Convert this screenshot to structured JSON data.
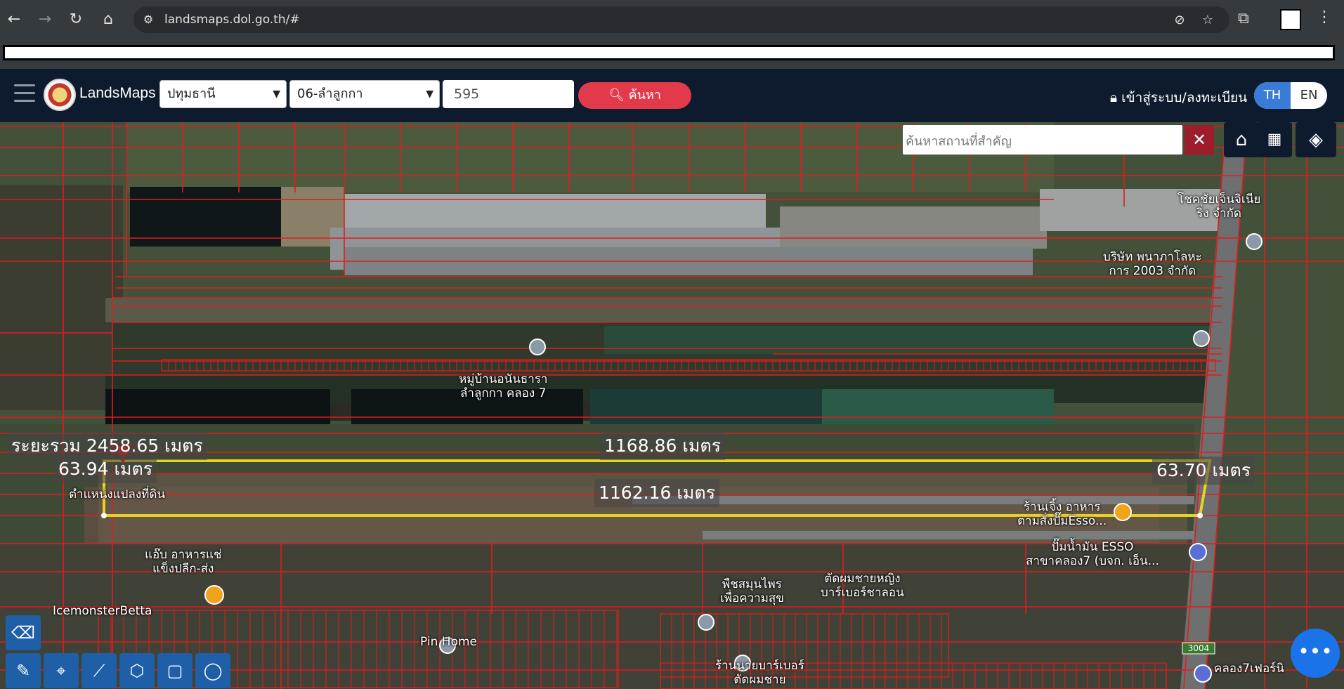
{
  "browser": {
    "url": "landsmaps.dol.go.th/#"
  },
  "header": {
    "brand": "LandsMaps",
    "province": "ปทุมธานี",
    "district": "06-ลำลูกกา",
    "parcel_value": "595",
    "search_label": "ค้นหา",
    "login_label": "เข้าสู่ระบบ/ลงทะเบียน",
    "lang_th": "TH",
    "lang_en": "EN"
  },
  "map": {
    "place_search_placeholder": "ค้นหาสถานที่สำคัญ",
    "measurements": {
      "total": "ระยะรวม 2458.65 เมตร",
      "top": "1168.86 เมตร",
      "bottom": "1162.16 เมตร",
      "left": "63.94 เมตร",
      "right": "63.70 เมตร"
    },
    "pois": {
      "chokchai_1": "โชคชัยเจ็นจิเนีย",
      "chokchai_2": "ริ่ง จำกัด",
      "company_1": "บริษัท พนาภาโลหะ",
      "company_2": "การ 2003 จำกัด",
      "village_1": "หมู่บ้านอนันธารา",
      "village_2": "ลำลูกกา คลอง 7",
      "parcel_location": "ตำแหน่งแปลงที่ดิน",
      "restaurant_1": "ร้านเจิ้ง อาหาร",
      "restaurant_2": "ตามสั่งปั๊มEsso...",
      "esso_1": "ปั๊มน้ำมัน ESSO",
      "esso_2": "สาขาคลอง7 (บจก. เอ็น...",
      "frozen_1": "แอ๊บ อาหารแช่",
      "frozen_2": "แข็งปลีก-ส่ง",
      "icemonster": "IcemonsterBetta",
      "herb_1": "พืชสมุนไพร",
      "herb_2": "เพื่อความสุข",
      "barber_1": "ตัดผมชายหญิง",
      "barber_2": "บาร์เบอร์ชาลอน",
      "pinhome": "Pin Home",
      "barber2_1": "ร้านนายบาร์เบอร์",
      "barber2_2": "ตัดผมชาย",
      "klong7": "คลอง7เฟอร์นิ",
      "road_sign": "3004"
    }
  }
}
